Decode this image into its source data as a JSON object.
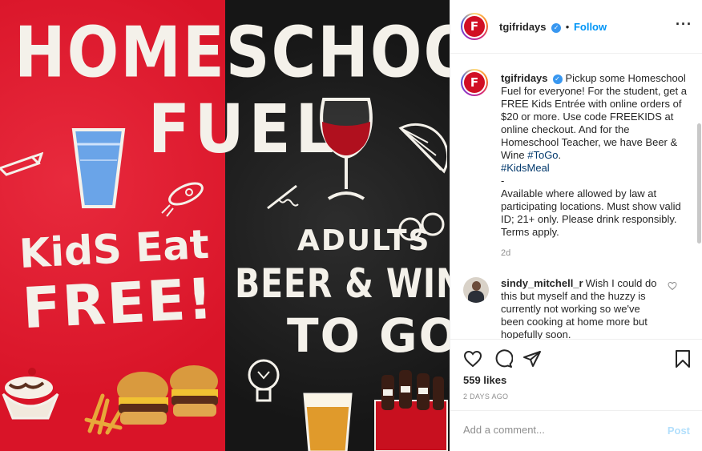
{
  "image": {
    "headline_line1": "HOMESCHOOL",
    "headline_line2": "FUEL",
    "kids_line1": "KidS Eat",
    "kids_line2": "FREE!",
    "adults_line1": "ADULTS",
    "adults_line2": "BEER & WINE",
    "adults_line3": "TO GO",
    "colors": {
      "red": "#e0192e",
      "black": "#1f1f1f",
      "chalk": "#f4f1ea"
    }
  },
  "header": {
    "avatar_letter": "F",
    "username": "tgifridays",
    "verified_icon": "verified-badge-icon",
    "separator": "•",
    "follow_label": "Follow",
    "more_icon": "more-options-icon"
  },
  "caption": {
    "avatar_letter": "F",
    "username": "tgifridays",
    "text_part1": "Pickup some Homeschool Fuel for everyone! For the student, get a FREE Kids Entrée with online orders of $20 or more. Use code FREEKIDS at online checkout. And for the Homeschool Teacher, we have Beer & Wine ",
    "hashtag1": "#ToGo",
    "text_part2": ".",
    "hashtag2": "#KidsMeal",
    "text_part3": "-",
    "text_part4": "Available where allowed by law at participating locations. Must show valid ID; 21+ only. Please drink responsibly. Terms apply.",
    "time": "2d"
  },
  "comments": [
    {
      "username": "sindy_mitchell_r",
      "text": "Wish I could do this but myself and the huzzy is currently not working so we've been cooking at home more but hopefully soon."
    }
  ],
  "actions": {
    "like_icon": "heart-icon",
    "comment_icon": "comment-icon",
    "share_icon": "share-icon",
    "save_icon": "bookmark-icon",
    "likes": "559 likes",
    "date": "2 DAYS AGO"
  },
  "add_comment": {
    "placeholder": "Add a comment...",
    "post_label": "Post"
  }
}
